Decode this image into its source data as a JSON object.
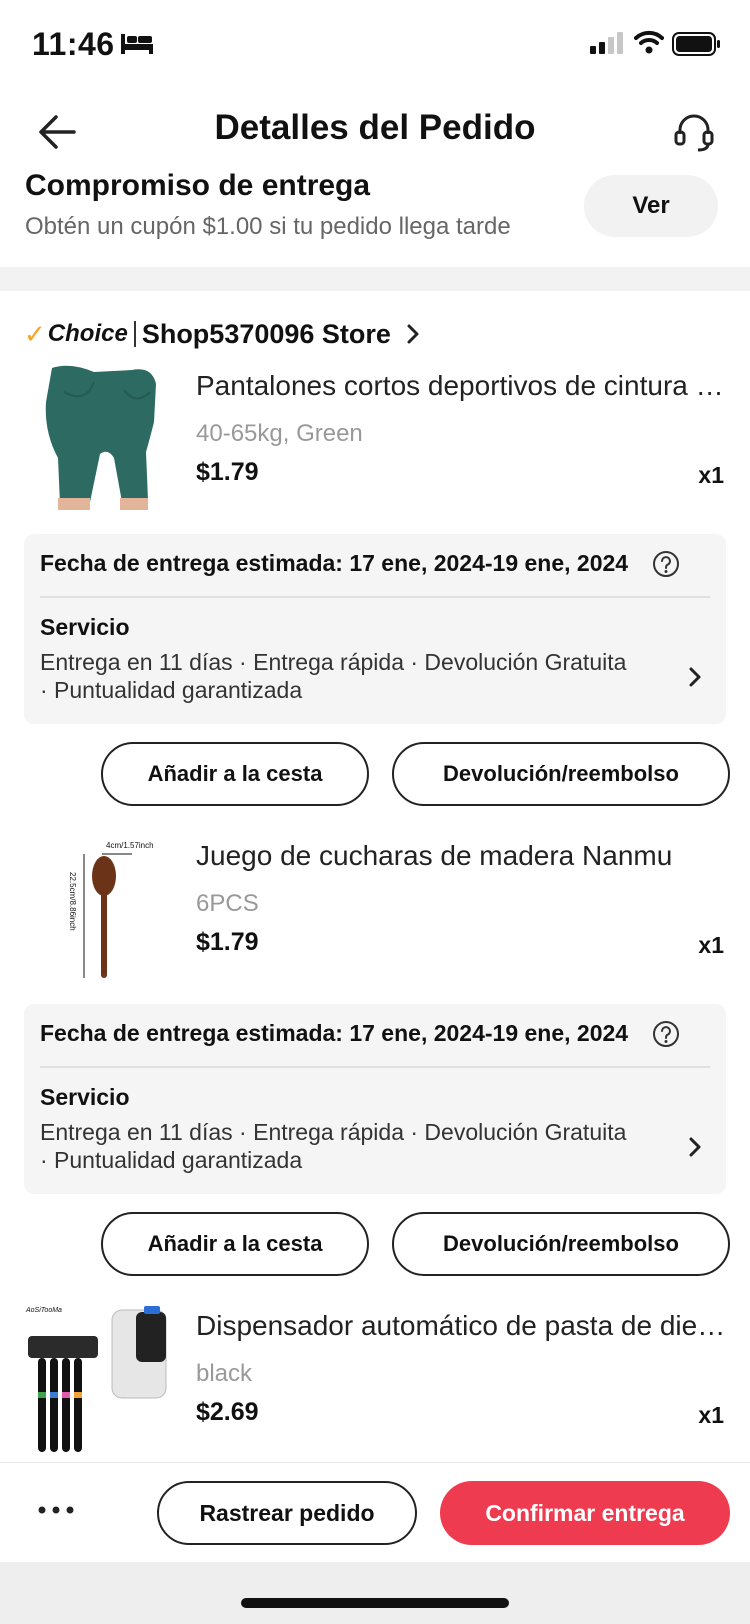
{
  "status_bar": {
    "time": "11:46"
  },
  "header": {
    "title": "Detalles del Pedido"
  },
  "commitment": {
    "title": "Compromiso de entrega",
    "subtitle": "Obtén un cupón $1.00 si tu pedido llega tarde",
    "button_label": "Ver"
  },
  "store": {
    "badge": "Choice",
    "name": "Shop5370096 Store"
  },
  "products": [
    {
      "name": "Pantalones cortos deportivos de cintura alta",
      "variant": "40-65kg, Green",
      "price": "$1.79",
      "qty": "x1",
      "delivery_date": "Fecha de entrega estimada: 17 ene, 2024-19 ene, 2024",
      "service_title": "Servicio",
      "service_desc": "Entrega en 11 días · Entrega rápida · Devolución Gratuita · Puntualidad garantizada",
      "add_to_cart": "Añadir a la cesta",
      "refund": "Devolución/reembolso"
    },
    {
      "name": "Juego de cucharas de madera Nanmu",
      "variant": "6PCS",
      "price": "$1.79",
      "qty": "x1",
      "image_label_width": "4cm/1.57inch",
      "image_label_height": "22.5cm/8.86inch",
      "delivery_date": "Fecha de entrega estimada: 17 ene, 2024-19 ene, 2024",
      "service_title": "Servicio",
      "service_desc": "Entrega en 11 días · Entrega rápida · Devolución Gratuita · Puntualidad garantizada",
      "add_to_cart": "Añadir a la cesta",
      "refund": "Devolución/reembolso"
    },
    {
      "name": "Dispensador automático de pasta de dientes",
      "variant": "black",
      "price": "$2.69",
      "qty": "x1",
      "image_brand": "AoSiTooMa"
    }
  ],
  "bottom_bar": {
    "track_label": "Rastrear pedido",
    "confirm_label": "Confirmar entrega"
  },
  "colors": {
    "accent": "#ef3b4f",
    "choice_check": "#f5a623"
  },
  "icons": [
    "bed-icon",
    "signal-icon",
    "wifi-icon",
    "battery-icon",
    "back-arrow-icon",
    "headset-icon",
    "chevron-right-icon",
    "help-icon",
    "more-icon"
  ]
}
